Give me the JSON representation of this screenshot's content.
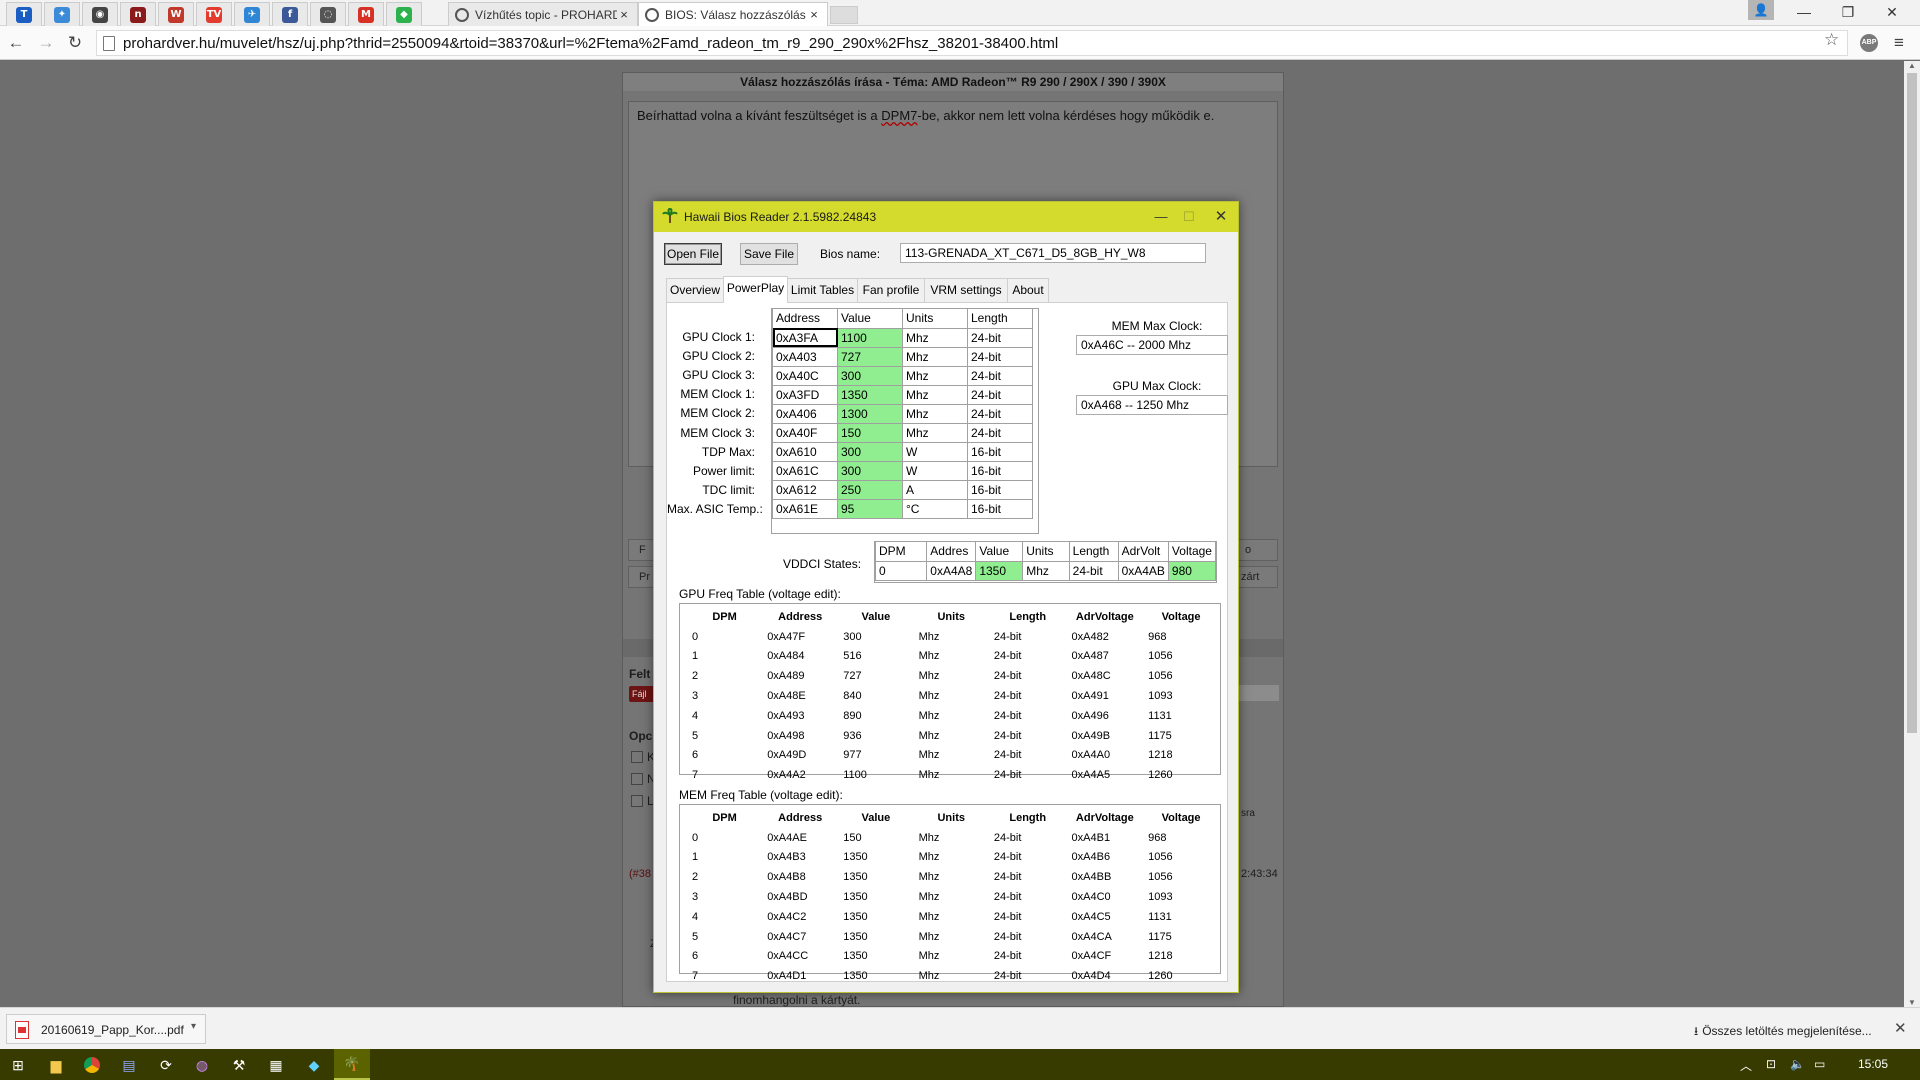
{
  "browser": {
    "pinned_tabs": [
      {
        "name": "trello-icon",
        "glyph": "T",
        "color": "#1a5ec4"
      },
      {
        "name": "app-tab-icon",
        "glyph": "✦",
        "color": "#3b8bd8"
      },
      {
        "name": "chrome-icon",
        "glyph": "◉",
        "color": "#444444"
      },
      {
        "name": "red-app-icon",
        "glyph": "n",
        "color": "#8b1a1a"
      },
      {
        "name": "news-icon",
        "glyph": "W",
        "color": "#c0392b"
      },
      {
        "name": "tv-icon",
        "glyph": "TV",
        "color": "#e33b2e"
      },
      {
        "name": "bird-icon",
        "glyph": "✈",
        "color": "#2e86d4"
      },
      {
        "name": "facebook-icon",
        "glyph": "f",
        "color": "#3b5998"
      },
      {
        "name": "chat-icon",
        "glyph": "◌",
        "color": "#555555"
      },
      {
        "name": "gmail-icon",
        "glyph": "M",
        "color": "#d93025"
      },
      {
        "name": "feedly-icon",
        "glyph": "◆",
        "color": "#2bb24c"
      }
    ],
    "tabs": [
      {
        "title": "Vízhűtés topic - PROHARD",
        "close": "×"
      },
      {
        "title": "BIOS: Válasz hozzászólás",
        "close": "×"
      }
    ],
    "url": "prohardver.hu/muvelet/hsz/uj.php?thrid=2550094&rtoid=38370&url=%2Ftema%2Famd_radeon_tm_r9_290_290x%2Fhsz_38201-38400.html"
  },
  "forum": {
    "title": "Válasz hozzászólás írása - Téma: AMD Radeon™ R9 290 / 290X / 390 / 390X",
    "reply_before": "Beírhattad volna a kívánt feszültséget is a ",
    "reply_misspelled": "DPM7",
    "reply_after": "-be, akkor nem lett volna kérdéses hogy működik e.",
    "frag_f": "F",
    "frag_p": "o",
    "frag_pr": "Pr",
    "frag_zart": "zárt",
    "frag_felt": "Felt",
    "frag_fajl": "Fájl",
    "frag_opci": "Opci",
    "frag_k": "K",
    "frag_n": "N",
    "frag_l": "L",
    "frag_sra": "sra",
    "frag_post_num": "(#38",
    "frag_time": "2:43:34",
    "frag_z": "Z",
    "frag_bottom": "finomhangolni a kártyát."
  },
  "downloads": {
    "file_name": "20160619_Papp_Kor....pdf",
    "show_all": "Összes letöltés megjelenítése..."
  },
  "taskbar": {
    "clock": "15:05"
  },
  "app": {
    "title": "Hawaii Bios Reader 2.1.5982.24843",
    "open_file": "Open File",
    "save_file": "Save File",
    "bios_name_label": "Bios name:",
    "bios_name": "113-GRENADA_XT_C671_D5_8GB_HY_W8",
    "tabs": [
      "Overview",
      "PowerPlay",
      "Limit Tables",
      "Fan profile",
      "VRM settings",
      "About"
    ],
    "active_tab": "PowerPlay",
    "powerplay": {
      "headers": [
        "Address",
        "Value",
        "Units",
        "Length"
      ],
      "rows": [
        {
          "label": "GPU Clock 1:",
          "address": "0xA3FA",
          "value": "1100",
          "units": "Mhz",
          "length": "24-bit"
        },
        {
          "label": "GPU Clock 2:",
          "address": "0xA403",
          "value": "727",
          "units": "Mhz",
          "length": "24-bit"
        },
        {
          "label": "GPU Clock 3:",
          "address": "0xA40C",
          "value": "300",
          "units": "Mhz",
          "length": "24-bit"
        },
        {
          "label": "MEM Clock 1:",
          "address": "0xA3FD",
          "value": "1350",
          "units": "Mhz",
          "length": "24-bit"
        },
        {
          "label": "MEM Clock 2:",
          "address": "0xA406",
          "value": "1300",
          "units": "Mhz",
          "length": "24-bit"
        },
        {
          "label": "MEM Clock 3:",
          "address": "0xA40F",
          "value": "150",
          "units": "Mhz",
          "length": "24-bit"
        },
        {
          "label": "TDP Max:",
          "address": "0xA610",
          "value": "300",
          "units": "W",
          "length": "16-bit"
        },
        {
          "label": "Power limit:",
          "address": "0xA61C",
          "value": "300",
          "units": "W",
          "length": "16-bit"
        },
        {
          "label": "TDC limit:",
          "address": "0xA612",
          "value": "250",
          "units": "A",
          "length": "16-bit"
        },
        {
          "label": "Max. ASIC Temp.:",
          "address": "0xA61E",
          "value": "95",
          "units": "°C",
          "length": "16-bit"
        }
      ]
    },
    "mem_max_clock_label": "MEM Max Clock:",
    "mem_max_clock": "0xA46C -- 2000 Mhz",
    "gpu_max_clock_label": "GPU Max Clock:",
    "gpu_max_clock": "0xA468 -- 1250 Mhz",
    "vddci": {
      "label": "VDDCI States:",
      "headers": [
        "DPM",
        "Addres",
        "Value",
        "Units",
        "Length",
        "AdrVolt",
        "Voltage"
      ],
      "row": [
        "0",
        "0xA4A8",
        "1350",
        "Mhz",
        "24-bit",
        "0xA4AB",
        "980"
      ]
    },
    "gpu_freq": {
      "label": "GPU Freq Table (voltage edit):",
      "headers": [
        "DPM",
        "Address",
        "Value",
        "Units",
        "Length",
        "AdrVoltage",
        "Voltage"
      ],
      "rows": [
        [
          "0",
          "0xA47F",
          "300",
          "Mhz",
          "24-bit",
          "0xA482",
          "968"
        ],
        [
          "1",
          "0xA484",
          "516",
          "Mhz",
          "24-bit",
          "0xA487",
          "1056"
        ],
        [
          "2",
          "0xA489",
          "727",
          "Mhz",
          "24-bit",
          "0xA48C",
          "1056"
        ],
        [
          "3",
          "0xA48E",
          "840",
          "Mhz",
          "24-bit",
          "0xA491",
          "1093"
        ],
        [
          "4",
          "0xA493",
          "890",
          "Mhz",
          "24-bit",
          "0xA496",
          "1131"
        ],
        [
          "5",
          "0xA498",
          "936",
          "Mhz",
          "24-bit",
          "0xA49B",
          "1175"
        ],
        [
          "6",
          "0xA49D",
          "977",
          "Mhz",
          "24-bit",
          "0xA4A0",
          "1218"
        ],
        [
          "7",
          "0xA4A2",
          "1100",
          "Mhz",
          "24-bit",
          "0xA4A5",
          "1260"
        ]
      ]
    },
    "mem_freq": {
      "label": "MEM Freq Table (voltage edit):",
      "headers": [
        "DPM",
        "Address",
        "Value",
        "Units",
        "Length",
        "AdrVoltage",
        "Voltage"
      ],
      "rows": [
        [
          "0",
          "0xA4AE",
          "150",
          "Mhz",
          "24-bit",
          "0xA4B1",
          "968"
        ],
        [
          "1",
          "0xA4B3",
          "1350",
          "Mhz",
          "24-bit",
          "0xA4B6",
          "1056"
        ],
        [
          "2",
          "0xA4B8",
          "1350",
          "Mhz",
          "24-bit",
          "0xA4BB",
          "1056"
        ],
        [
          "3",
          "0xA4BD",
          "1350",
          "Mhz",
          "24-bit",
          "0xA4C0",
          "1093"
        ],
        [
          "4",
          "0xA4C2",
          "1350",
          "Mhz",
          "24-bit",
          "0xA4C5",
          "1131"
        ],
        [
          "5",
          "0xA4C7",
          "1350",
          "Mhz",
          "24-bit",
          "0xA4CA",
          "1175"
        ],
        [
          "6",
          "0xA4CC",
          "1350",
          "Mhz",
          "24-bit",
          "0xA4CF",
          "1218"
        ],
        [
          "7",
          "0xA4D1",
          "1350",
          "Mhz",
          "24-bit",
          "0xA4D4",
          "1260"
        ]
      ]
    }
  }
}
